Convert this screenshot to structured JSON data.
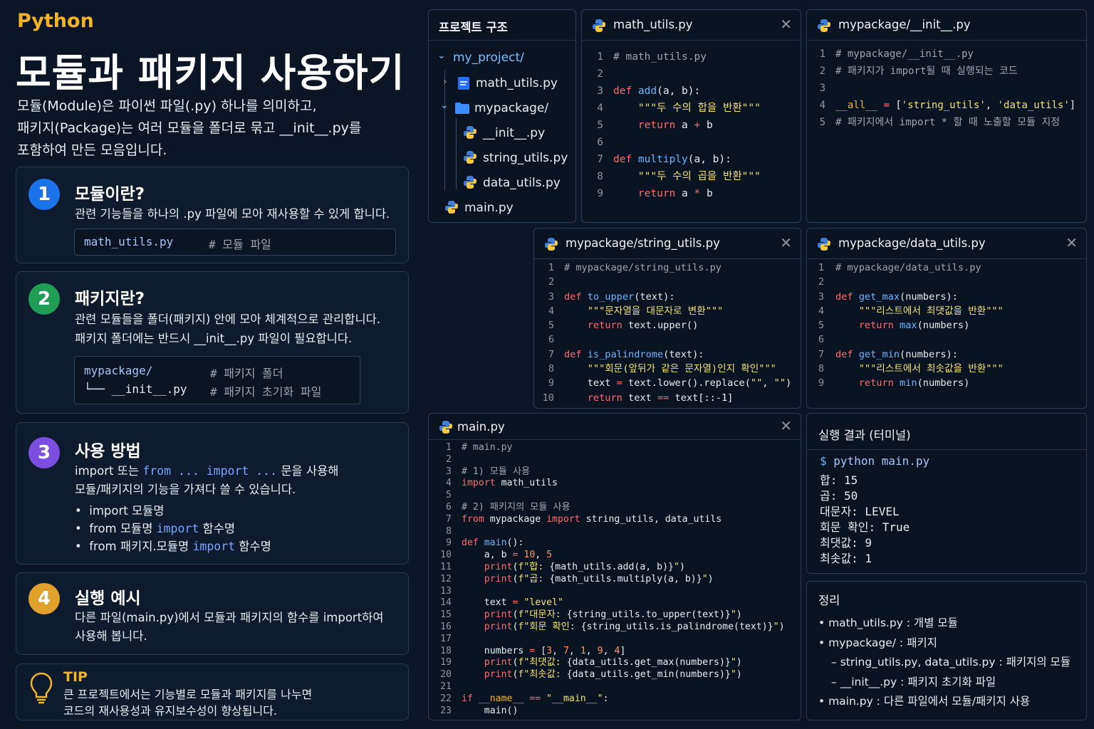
{
  "header": {
    "brand": "Python",
    "title": "모듈과 패키지 사용하기",
    "intro": [
      "모듈(Module)은 파이썬 파일(.py) 하나를 의미하고,",
      "패키지(Package)는 여러 모듈을 폴더로 묶고 __init__.py를",
      "포함하여 만든 모음입니다."
    ]
  },
  "cards": [
    {
      "num": "1",
      "title": "모듈이란?",
      "lines": [
        "관련 기능들을 하나의 .py 파일에 모아 재사용할 수 있게 합니다."
      ],
      "code": [
        {
          "left": "math_utils.py",
          "right": "# 모듈 파일"
        }
      ]
    },
    {
      "num": "2",
      "title": "패키지란?",
      "lines": [
        "관련 모듈들을 폴더(패키지) 안에 모아 체계적으로 관리합니다.",
        "패키지 폴더에는 반드시 __init__.py 파일이 필요합니다."
      ],
      "code": [
        {
          "left": "mypackage/",
          "right": "# 패키지 폴더"
        },
        {
          "left": "└── __init__.py",
          "right": "# 패키지 초기화 파일"
        }
      ]
    },
    {
      "num": "3",
      "title": "사용 방법",
      "line1_a": "import 또는 ",
      "line1_b": "from ... import ...",
      "line1_c": " 문을 사용해",
      "line2": "모듈/패키지의 기능을 가져다 쓸 수 있습니다.",
      "bullets": [
        {
          "a": "import 모듈명",
          "k": "",
          "b": ""
        },
        {
          "a": "from 모듈명 ",
          "k": "import",
          "b": " 함수명"
        },
        {
          "a": "from 패키지.모듈명 ",
          "k": "import",
          "b": " 함수명"
        }
      ]
    },
    {
      "num": "4",
      "title": "실행 예시",
      "lines": [
        "다른 파일(main.py)에서 모듈과 패키지의 함수를 import하여",
        "사용해 봅니다."
      ]
    }
  ],
  "tip": {
    "title": "TIP",
    "lines": [
      "큰 프로젝트에서는 기능별로 모듈과 패키지를 나누면",
      "코드의 재사용성과 유지보수성이 향상됩니다."
    ]
  },
  "tree": {
    "title": "프로젝트 구조",
    "root": "my_project/",
    "math": "math_utils.py",
    "pkg": "mypackage/",
    "init": "__init__.py",
    "string": "string_utils.py",
    "data": "data_utils.py",
    "main": "main.py"
  },
  "panels": {
    "math_utils": {
      "title": "math_utils.py",
      "close": "✕"
    },
    "init": {
      "title": "mypackage/__init__.py"
    },
    "string_utils": {
      "title": "mypackage/string_utils.py",
      "close": "✕"
    },
    "data_utils": {
      "title": "mypackage/data_utils.py",
      "close": "✕"
    },
    "main": {
      "title": "main.py",
      "close": "✕"
    },
    "terminal": {
      "title": "실행 결과 (터미널)"
    },
    "summary": {
      "title": "정리"
    }
  },
  "code": {
    "math_utils": [
      [
        "1",
        [
          [
            "c-cm",
            "# math_utils.py"
          ]
        ]
      ],
      [
        "2",
        []
      ],
      [
        "3",
        [
          [
            "c-kw",
            "def "
          ],
          [
            "c-fn",
            "add"
          ],
          [
            "",
            "(a, b):"
          ]
        ]
      ],
      [
        "4",
        [
          [
            "",
            "    "
          ],
          [
            "c-str",
            "\"\"\"두 수의 합을 반환\"\"\""
          ]
        ]
      ],
      [
        "5",
        [
          [
            "",
            "    "
          ],
          [
            "c-kw",
            "return "
          ],
          [
            "",
            "a "
          ],
          [
            "c-op",
            "+"
          ],
          [
            "",
            " b"
          ]
        ]
      ],
      [
        "6",
        []
      ],
      [
        "7",
        [
          [
            "c-kw",
            "def "
          ],
          [
            "c-fn",
            "multiply"
          ],
          [
            "",
            "(a, b):"
          ]
        ]
      ],
      [
        "8",
        [
          [
            "",
            "    "
          ],
          [
            "c-str",
            "\"\"\"두 수의 곱을 반환\"\"\""
          ]
        ]
      ],
      [
        "9",
        [
          [
            "",
            "    "
          ],
          [
            "c-kw",
            "return "
          ],
          [
            "",
            "a "
          ],
          [
            "c-op",
            "*"
          ],
          [
            "",
            " b"
          ]
        ]
      ]
    ],
    "init": [
      [
        "1",
        [
          [
            "c-cm",
            "# mypackage/__init__.py"
          ]
        ]
      ],
      [
        "2",
        [
          [
            "c-cm",
            "# 패키지가 import될 때 실행되는 코드"
          ]
        ]
      ],
      [
        "3",
        []
      ],
      [
        "4",
        [
          [
            "c-dunder",
            "__all__"
          ],
          [
            "",
            " "
          ],
          [
            "c-op",
            "="
          ],
          [
            "",
            " ["
          ],
          [
            "c-str",
            "'string_utils'"
          ],
          [
            "",
            ", "
          ],
          [
            "c-str",
            "'data_utils'"
          ],
          [
            "",
            "]"
          ]
        ]
      ],
      [
        "5",
        [
          [
            "c-cm",
            "# 패키지에서 import * 할 때 노출할 모듈 지정"
          ]
        ]
      ]
    ],
    "string_utils": [
      [
        "1",
        [
          [
            "c-cm",
            "# mypackage/string_utils.py"
          ]
        ]
      ],
      [
        "2",
        []
      ],
      [
        "3",
        [
          [
            "c-kw",
            "def "
          ],
          [
            "c-fn",
            "to_upper"
          ],
          [
            "",
            "(text):"
          ]
        ]
      ],
      [
        "4",
        [
          [
            "",
            "    "
          ],
          [
            "c-str",
            "\"\"\"문자열을 대문자로 변환\"\"\""
          ]
        ]
      ],
      [
        "5",
        [
          [
            "",
            "    "
          ],
          [
            "c-kw",
            "return "
          ],
          [
            "",
            "text.upper()"
          ]
        ]
      ],
      [
        "6",
        []
      ],
      [
        "7",
        [
          [
            "c-kw",
            "def "
          ],
          [
            "c-fn",
            "is_palindrome"
          ],
          [
            "",
            "(text):"
          ]
        ]
      ],
      [
        "8",
        [
          [
            "",
            "    "
          ],
          [
            "c-str",
            "\"\"\"회문(앞뒤가 같은 문자열)인지 확인\"\"\""
          ]
        ]
      ],
      [
        "9",
        [
          [
            "",
            "    text "
          ],
          [
            "c-op",
            "="
          ],
          [
            "",
            " text.lower().replace("
          ],
          [
            "c-str",
            "\"\""
          ],
          [
            "",
            ", "
          ],
          [
            "c-str",
            "\"\""
          ],
          [
            "",
            ")"
          ]
        ]
      ],
      [
        "10",
        [
          [
            "",
            "    "
          ],
          [
            "c-kw",
            "return "
          ],
          [
            "",
            "text "
          ],
          [
            "c-op",
            "=="
          ],
          [
            "",
            " text[::-1]"
          ]
        ]
      ]
    ],
    "data_utils": [
      [
        "1",
        [
          [
            "c-cm",
            "# mypackage/data_utils.py"
          ]
        ]
      ],
      [
        "2",
        []
      ],
      [
        "3",
        [
          [
            "c-kw",
            "def "
          ],
          [
            "c-fn",
            "get_max"
          ],
          [
            "",
            "(numbers):"
          ]
        ]
      ],
      [
        "4",
        [
          [
            "",
            "    "
          ],
          [
            "c-str",
            "\"\"\"리스트에서 최댓값을 반환\"\"\""
          ]
        ]
      ],
      [
        "5",
        [
          [
            "",
            "    "
          ],
          [
            "c-kw",
            "return "
          ],
          [
            "c-fn",
            "max"
          ],
          [
            "",
            "(numbers)"
          ]
        ]
      ],
      [
        "6",
        []
      ],
      [
        "7",
        [
          [
            "c-kw",
            "def "
          ],
          [
            "c-fn",
            "get_min"
          ],
          [
            "",
            "(numbers):"
          ]
        ]
      ],
      [
        "8",
        [
          [
            "",
            "    "
          ],
          [
            "c-str",
            "\"\"\"리스트에서 최솟값을 반환\"\"\""
          ]
        ]
      ],
      [
        "9",
        [
          [
            "",
            "    "
          ],
          [
            "c-kw",
            "return "
          ],
          [
            "c-fn",
            "min"
          ],
          [
            "",
            "(numbers)"
          ]
        ]
      ]
    ],
    "main": [
      [
        "1",
        [
          [
            "c-cm",
            "# main.py"
          ]
        ]
      ],
      [
        "2",
        []
      ],
      [
        "3",
        [
          [
            "c-cm",
            "# 1) 모듈 사용"
          ]
        ]
      ],
      [
        "4",
        [
          [
            "c-kw",
            "import "
          ],
          [
            "",
            "math_utils"
          ]
        ]
      ],
      [
        "5",
        []
      ],
      [
        "6",
        [
          [
            "c-cm",
            "# 2) 패키지의 모듈 사용"
          ]
        ]
      ],
      [
        "7",
        [
          [
            "c-kw",
            "from "
          ],
          [
            "",
            "mypackage "
          ],
          [
            "c-kw",
            "import "
          ],
          [
            "",
            "string_utils, data_utils"
          ]
        ]
      ],
      [
        "8",
        []
      ],
      [
        "9",
        [
          [
            "c-kw",
            "def "
          ],
          [
            "c-fn",
            "main"
          ],
          [
            "",
            "():"
          ]
        ]
      ],
      [
        "10",
        [
          [
            "",
            "    a, b "
          ],
          [
            "c-op",
            "="
          ],
          [
            "",
            " "
          ],
          [
            "c-num",
            "10"
          ],
          [
            "",
            ", "
          ],
          [
            "c-num",
            "5"
          ]
        ]
      ],
      [
        "11",
        [
          [
            "",
            "    "
          ],
          [
            "c-kw",
            "print"
          ],
          [
            "",
            "("
          ],
          [
            "c-str",
            "f\"합: "
          ],
          [
            "",
            "{math_utils.add(a, b)}"
          ],
          [
            "c-str",
            "\""
          ],
          [
            "",
            ")"
          ]
        ]
      ],
      [
        "12",
        [
          [
            "",
            "    "
          ],
          [
            "c-kw",
            "print"
          ],
          [
            "",
            "("
          ],
          [
            "c-str",
            "f\"곱: "
          ],
          [
            "",
            "{math_utils.multiply(a, b)}"
          ],
          [
            "c-str",
            "\""
          ],
          [
            "",
            ")"
          ]
        ]
      ],
      [
        "13",
        []
      ],
      [
        "14",
        [
          [
            "",
            "    text "
          ],
          [
            "c-op",
            "="
          ],
          [
            "",
            " "
          ],
          [
            "c-str",
            "\"level\""
          ]
        ]
      ],
      [
        "15",
        [
          [
            "",
            "    "
          ],
          [
            "c-kw",
            "print"
          ],
          [
            "",
            "("
          ],
          [
            "c-str",
            "f\"대문자: "
          ],
          [
            "",
            "{string_utils.to_upper(text)}"
          ],
          [
            "c-str",
            "\""
          ],
          [
            "",
            ")"
          ]
        ]
      ],
      [
        "16",
        [
          [
            "",
            "    "
          ],
          [
            "c-kw",
            "print"
          ],
          [
            "",
            "("
          ],
          [
            "c-str",
            "f\"회문 확인: "
          ],
          [
            "",
            "{string_utils.is_palindrome(text)}"
          ],
          [
            "c-str",
            "\""
          ],
          [
            "",
            ")"
          ]
        ]
      ],
      [
        "17",
        []
      ],
      [
        "18",
        [
          [
            "",
            "    numbers "
          ],
          [
            "c-op",
            "="
          ],
          [
            "",
            " ["
          ],
          [
            "c-num",
            "3"
          ],
          [
            "",
            ", "
          ],
          [
            "c-num",
            "7"
          ],
          [
            "",
            ", "
          ],
          [
            "c-num",
            "1"
          ],
          [
            "",
            ", "
          ],
          [
            "c-num",
            "9"
          ],
          [
            "",
            ", "
          ],
          [
            "c-num",
            "4"
          ],
          [
            "",
            "]"
          ]
        ]
      ],
      [
        "19",
        [
          [
            "",
            "    "
          ],
          [
            "c-kw",
            "print"
          ],
          [
            "",
            "("
          ],
          [
            "c-str",
            "f\"최댓값: "
          ],
          [
            "",
            "{data_utils.get_max(numbers)}"
          ],
          [
            "c-str",
            "\""
          ],
          [
            "",
            ")"
          ]
        ]
      ],
      [
        "20",
        [
          [
            "",
            "    "
          ],
          [
            "c-kw",
            "print"
          ],
          [
            "",
            "("
          ],
          [
            "c-str",
            "f\"최솟값: "
          ],
          [
            "",
            "{data_utils.get_min(numbers)}"
          ],
          [
            "c-str",
            "\""
          ],
          [
            "",
            ")"
          ]
        ]
      ],
      [
        "21",
        []
      ],
      [
        "22",
        [
          [
            "c-kw",
            "if "
          ],
          [
            "c-dunder",
            "__name__"
          ],
          [
            "",
            " "
          ],
          [
            "c-op",
            "=="
          ],
          [
            "",
            " "
          ],
          [
            "c-str",
            "\"__main__\""
          ],
          [
            "",
            ":"
          ]
        ]
      ],
      [
        "23",
        [
          [
            "",
            "    main()"
          ]
        ]
      ]
    ]
  },
  "terminal": {
    "prompt": "$",
    "command": "python main.py",
    "output": [
      "합: 15",
      "곱: 50",
      "대문자: LEVEL",
      "회문 확인: True",
      "최댓값: 9",
      "최솟값: 1"
    ]
  },
  "summary": {
    "items": [
      {
        "text": "math_utils.py : 개별 모듈",
        "level": 0
      },
      {
        "text": "mypackage/ : 패키지",
        "level": 0
      },
      {
        "text": "string_utils.py, data_utils.py : 패키지의 모듈",
        "level": 1
      },
      {
        "text": "__init__.py : 패키지 초기화 파일",
        "level": 1
      },
      {
        "text": "main.py : 다른 파일에서 모듈/패키지 사용",
        "level": 0
      }
    ]
  },
  "colors": {
    "card1": "#1a73e8",
    "card2": "#1f9d55",
    "card3": "#7b4ee0",
    "card4": "#e0a22b",
    "brand": "#f0b429"
  }
}
